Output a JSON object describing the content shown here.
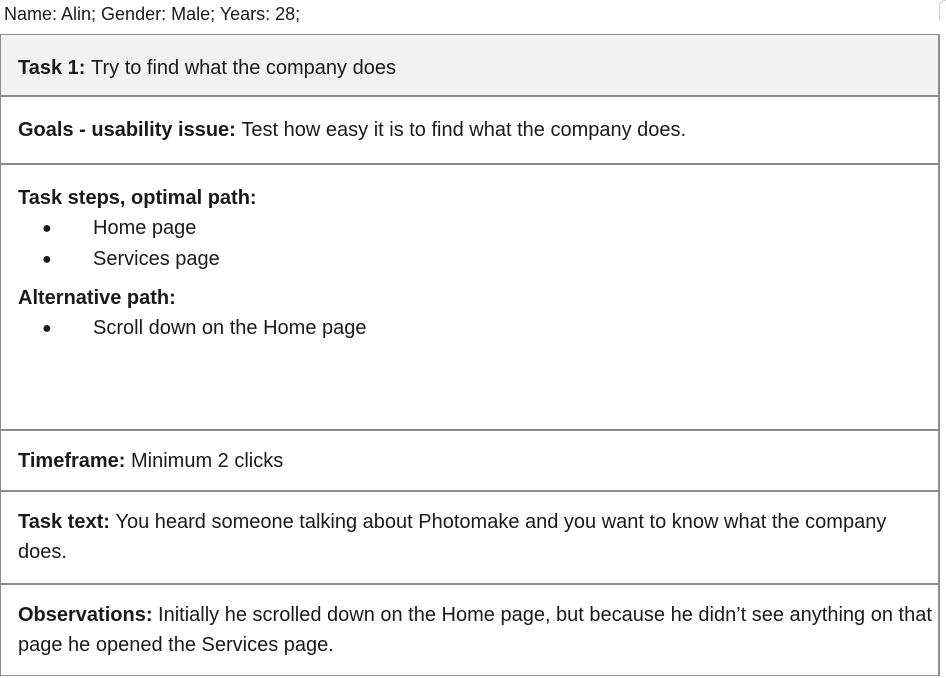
{
  "header": {
    "participant": "Name: Alin; Gender: Male; Years: 28;"
  },
  "task": {
    "label": "Task 1:",
    "value": "Try to find what the company does"
  },
  "goals": {
    "label": "Goals - usability issue:",
    "value": "Test how easy it is to find what the company does."
  },
  "steps": {
    "optimal_label": "Task steps, optimal path:",
    "optimal_items": [
      "Home page",
      "Services page"
    ],
    "alternative_label": "Alternative path:",
    "alternative_items": [
      "Scroll down on the Home page"
    ]
  },
  "timeframe": {
    "label": "Timeframe:",
    "value": "Minimum 2 clicks"
  },
  "task_text": {
    "label": "Task text:",
    "value": "You heard someone talking about Photomake and you want to know what the company does."
  },
  "observations": {
    "label": "Observations:",
    "value": "Initially he scrolled down on the Home page, but because he didn’t see anything on that page he opened the Services page."
  },
  "bullet_glyph": "●"
}
